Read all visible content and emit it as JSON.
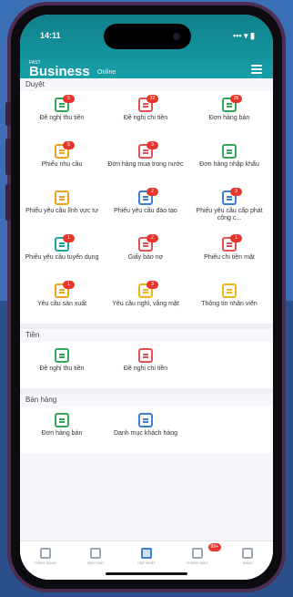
{
  "status": {
    "time": "14:11",
    "signal": "••• ▾ ▮"
  },
  "header": {
    "brand_small": "FAST",
    "brand": "Business",
    "brand_sub": "Online"
  },
  "sections": [
    {
      "title": "Duyệt",
      "items": [
        {
          "label": "Đề nghị thu tiền",
          "icon": "document-icon",
          "color": "green",
          "badge": "5"
        },
        {
          "label": "Đề nghị chi tiền",
          "icon": "document-icon",
          "color": "red",
          "badge": "22"
        },
        {
          "label": "Đơn hàng bán",
          "icon": "document-icon",
          "color": "green",
          "badge": "26"
        },
        {
          "label": "Phiếu nhu cầu",
          "icon": "document-icon",
          "color": "orange",
          "badge": "5"
        },
        {
          "label": "Đơn hàng mua trong nước",
          "icon": "document-icon",
          "color": "red",
          "badge": "3"
        },
        {
          "label": "Đơn hàng nhập khẩu",
          "icon": "document-icon",
          "color": "green",
          "badge": ""
        },
        {
          "label": "Phiếu yêu cầu lĩnh vực tư",
          "icon": "document-icon",
          "color": "orange",
          "badge": ""
        },
        {
          "label": "Phiếu yêu cầu đào tạo",
          "icon": "document-icon",
          "color": "blue",
          "badge": "2"
        },
        {
          "label": "Phiếu yêu cầu cấp phát công c...",
          "icon": "document-icon",
          "color": "blue",
          "badge": "3"
        },
        {
          "label": "Phiếu yêu cầu tuyển dụng",
          "icon": "document-icon",
          "color": "teal",
          "badge": "1"
        },
        {
          "label": "Giấy báo nợ",
          "icon": "document-icon",
          "color": "red",
          "badge": "2"
        },
        {
          "label": "Phiếu chi tiền mặt",
          "icon": "document-icon",
          "color": "red",
          "badge": "1"
        },
        {
          "label": "Yêu cầu sản xuất",
          "icon": "document-icon",
          "color": "orange",
          "badge": "1"
        },
        {
          "label": "Yêu cầu nghỉ, vắng mặt",
          "icon": "document-icon",
          "color": "yellow",
          "badge": "3"
        },
        {
          "label": "Thông tin nhân viên",
          "icon": "document-icon",
          "color": "yellow",
          "badge": ""
        }
      ]
    },
    {
      "title": "Tiền",
      "items": [
        {
          "label": "Đề nghị thu tiền",
          "icon": "document-icon",
          "color": "green",
          "badge": ""
        },
        {
          "label": "Đề nghị chi tiền",
          "icon": "document-icon",
          "color": "red",
          "badge": ""
        }
      ]
    },
    {
      "title": "Bán hàng",
      "items": [
        {
          "label": "Đơn hàng bán",
          "icon": "document-icon",
          "color": "green",
          "badge": ""
        },
        {
          "label": "Danh mục khách hàng",
          "icon": "document-icon",
          "color": "blue",
          "badge": ""
        }
      ]
    }
  ],
  "tabs": [
    {
      "label": "TỔNG QUAN",
      "icon": "home-icon",
      "active": false,
      "badge": ""
    },
    {
      "label": "BÁO CÁO",
      "icon": "report-icon",
      "active": false,
      "badge": ""
    },
    {
      "label": "CẬP NHẬT",
      "icon": "update-icon",
      "active": true,
      "badge": ""
    },
    {
      "label": "THÔNG BÁO",
      "icon": "bell-icon",
      "active": false,
      "badge": "99+"
    },
    {
      "label": "KHÁC",
      "icon": "more-icon",
      "active": false,
      "badge": ""
    }
  ]
}
